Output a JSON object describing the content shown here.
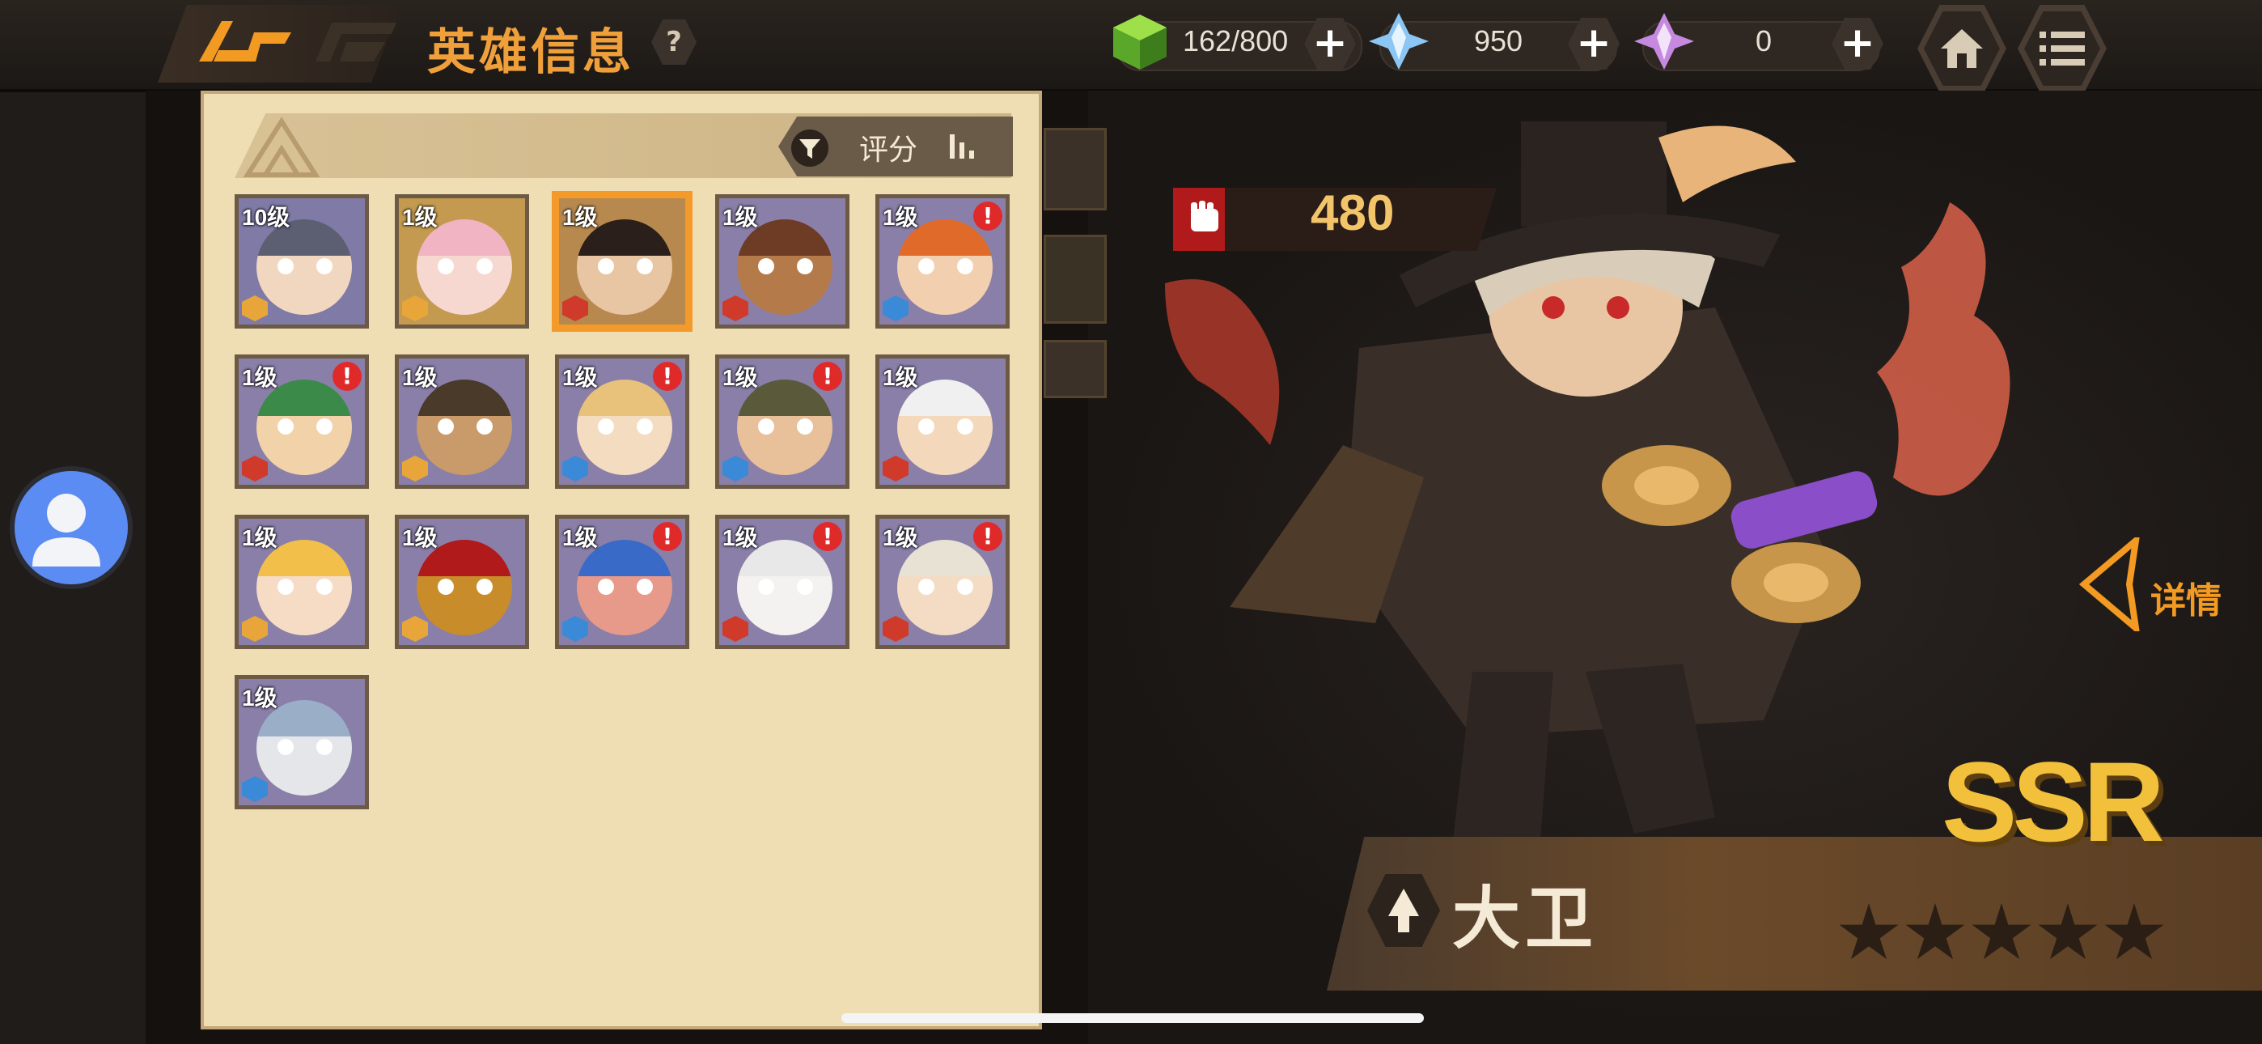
{
  "header": {
    "title": "英雄信息",
    "help_glyph": "?",
    "logo_icon": "game-logo-icon"
  },
  "resources": [
    {
      "name": "stamina",
      "icon": "green-cube-icon",
      "value": "162/800",
      "color": "#7cc23a"
    },
    {
      "name": "diamond",
      "icon": "blue-crystal-icon",
      "value": "950",
      "color": "#7ab6f0"
    },
    {
      "name": "premium-crystal",
      "icon": "purple-crystal-icon",
      "value": "0",
      "color": "#c58ae0"
    }
  ],
  "plus_glyph": "+",
  "nav": {
    "home_icon": "home-icon",
    "menu_icon": "menu-list-icon"
  },
  "sort": {
    "label": "评分",
    "filter_icon": "funnel-icon",
    "order_icon": "sort-bars-icon"
  },
  "heroes": [
    {
      "level": "10级",
      "alert": false,
      "selected": false,
      "bg": "#7f7aa6",
      "skin": "#f2d7c0",
      "hair": "#5c5f72",
      "cls_color": "#e8a63a"
    },
    {
      "level": "1级",
      "alert": false,
      "selected": false,
      "bg": "#c39a4f",
      "skin": "#f6d8d0",
      "hair": "#f0b4c2",
      "cls_color": "#e8a63a"
    },
    {
      "level": "1级",
      "alert": false,
      "selected": true,
      "bg": "#b7894e",
      "skin": "#e8c6a4",
      "hair": "#2a1f1a",
      "cls_color": "#d03a2a"
    },
    {
      "level": "1级",
      "alert": false,
      "selected": false,
      "bg": "#8a7fa8",
      "skin": "#b57a4a",
      "hair": "#6e3b24",
      "cls_color": "#d03a2a"
    },
    {
      "level": "1级",
      "alert": true,
      "selected": false,
      "bg": "#8a7fa8",
      "skin": "#f2cfae",
      "hair": "#e06a2a",
      "cls_color": "#3a8ad8"
    },
    {
      "level": "1级",
      "alert": true,
      "selected": false,
      "bg": "#8a7fa8",
      "skin": "#f2d2a8",
      "hair": "#3c8a4a",
      "cls_color": "#d03a2a"
    },
    {
      "level": "1级",
      "alert": false,
      "selected": false,
      "bg": "#8a7fa8",
      "skin": "#c99a6a",
      "hair": "#4a3a2a",
      "cls_color": "#e8a63a"
    },
    {
      "level": "1级",
      "alert": true,
      "selected": false,
      "bg": "#8a7fa8",
      "skin": "#f4dcc0",
      "hair": "#e8c27a",
      "cls_color": "#3a8ad8"
    },
    {
      "level": "1级",
      "alert": true,
      "selected": false,
      "bg": "#8a7fa8",
      "skin": "#e8c09a",
      "hair": "#5a5a3a",
      "cls_color": "#3a8ad8"
    },
    {
      "level": "1级",
      "alert": false,
      "selected": false,
      "bg": "#8a7fa8",
      "skin": "#f4d8bc",
      "hair": "#f0f0f0",
      "cls_color": "#d03a2a"
    },
    {
      "level": "1级",
      "alert": false,
      "selected": false,
      "bg": "#8a7fa8",
      "skin": "#f6dcc4",
      "hair": "#f2c04a",
      "cls_color": "#e8a63a"
    },
    {
      "level": "1级",
      "alert": false,
      "selected": false,
      "bg": "#8a7fa8",
      "skin": "#c98c2a",
      "hair": "#b01a1a",
      "cls_color": "#e8a63a"
    },
    {
      "level": "1级",
      "alert": true,
      "selected": false,
      "bg": "#8a7fa8",
      "skin": "#e89a8a",
      "hair": "#3a6ac8",
      "cls_color": "#3a8ad8"
    },
    {
      "level": "1级",
      "alert": true,
      "selected": false,
      "bg": "#8a7fa8",
      "skin": "#f4f2f0",
      "hair": "#e8e8e8",
      "cls_color": "#d03a2a"
    },
    {
      "level": "1级",
      "alert": true,
      "selected": false,
      "bg": "#8a7fa8",
      "skin": "#f4dcc4",
      "hair": "#e8e2d4",
      "cls_color": "#d03a2a"
    },
    {
      "level": "1级",
      "alert": false,
      "selected": false,
      "bg": "#8a7fa8",
      "skin": "#e4e6ea",
      "hair": "#9aaec8",
      "cls_color": "#3a8ad8"
    }
  ],
  "alert_glyph": "!",
  "selected_hero": {
    "power": "480",
    "power_icon": "fist-icon",
    "detail_label": "详情",
    "rarity": "SSR",
    "name": "大卫",
    "class_icon": "warrior-class-icon",
    "stars_filled": 0,
    "stars_total": 5
  },
  "colors": {
    "accent": "#f29a22",
    "panel_bg": "#efddb4",
    "alert": "#e02a2a",
    "selected_border": "#f39a2a"
  }
}
